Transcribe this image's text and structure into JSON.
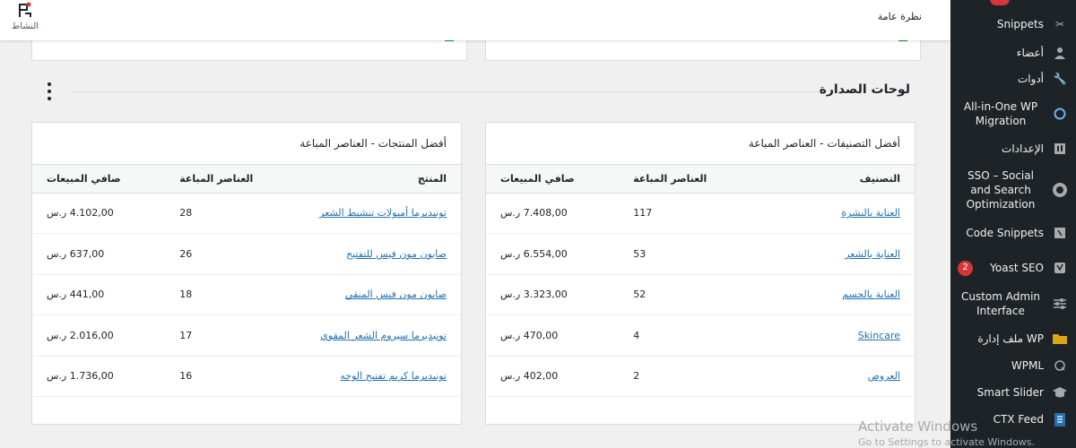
{
  "topbar": {
    "overview": "نظرة عامة",
    "activity_label": "النشاط"
  },
  "leaderboards": {
    "title": "لوحات الصدارة"
  },
  "categories_table": {
    "title": "أفضل التصنيفات - العناصر المباعة",
    "headers": [
      "التصنيف",
      "العناصر المباعة",
      "صافي المبيعات"
    ],
    "rows": [
      [
        "العناية بالبشرة",
        "117",
        "7.408,00 ر.س"
      ],
      [
        "العناية بالشعر",
        "53",
        "6.554,00 ر.س"
      ],
      [
        "العناية بالجسم",
        "52",
        "3.323,00 ر.س"
      ],
      [
        "Skincare",
        "4",
        "470,00 ر.س"
      ],
      [
        "العروض",
        "2",
        "402,00 ر.س"
      ]
    ]
  },
  "products_table": {
    "title": "أفضل المنتجات - العناصر المباعة",
    "headers": [
      "المنتج",
      "العناصر المباعة",
      "صافي المبيعات"
    ],
    "rows": [
      [
        "تونيديرما أمبولات تنشيط الشعر",
        "28",
        "4.102,00 ر.س"
      ],
      [
        "صابون مون فيس للتفتيح",
        "26",
        "637,00 ر.س"
      ],
      [
        "صابون مون فيس المنقي",
        "18",
        "441,00 ر.س"
      ],
      [
        "تونيديرما سيروم الشعر المقوي",
        "17",
        "2.016,00 ر.س"
      ],
      [
        "تونيديرما كريم تفتيح الوجه",
        "16",
        "1.736,00 ر.س"
      ]
    ]
  },
  "sidebar": {
    "items": [
      {
        "label": "Snippets",
        "icon": "scissors-icon"
      },
      {
        "label": "أعضاء",
        "icon": "user-icon"
      },
      {
        "label": "أدوات",
        "icon": "wrench-icon"
      },
      {
        "label": "All-in-One WP Migration",
        "icon": "migration-icon"
      },
      {
        "label": "الإعدادات",
        "icon": "settings-icon"
      },
      {
        "label": "SSO – Social and Search Optimization",
        "icon": "sso-icon"
      },
      {
        "label": "Code Snippets",
        "icon": "code-icon"
      },
      {
        "label": "Yoast SEO",
        "icon": "yoast-icon",
        "badge": "2"
      },
      {
        "label": "Custom Admin Interface",
        "icon": "sliders-icon"
      },
      {
        "label": "ملف إدارة WP",
        "icon": "folder-icon"
      },
      {
        "label": "WPML",
        "icon": "wpml-icon"
      },
      {
        "label": "Smart Slider",
        "icon": "graduation-icon"
      },
      {
        "label": "CTX Feed",
        "icon": "feed-icon"
      }
    ]
  },
  "watermark": {
    "line1": "Activate Windows",
    "line2": "Go to Settings to activate Windows."
  },
  "colors": {
    "sidebar_bg": "#1d2327",
    "link": "#2271b1",
    "badge": "#d63638",
    "accent_green": "#00a32a"
  }
}
